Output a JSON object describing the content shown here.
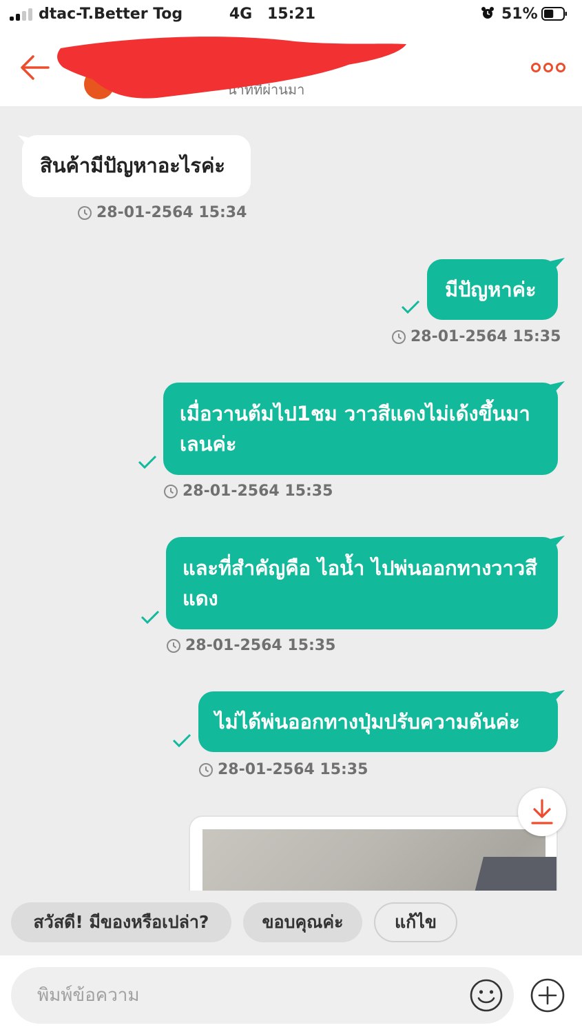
{
  "status_bar": {
    "carrier": "dtac-T.Better Tog",
    "network": "4G",
    "time": "15:21",
    "battery_percent": "51%",
    "battery_level": 0.51,
    "signal_bars": 2
  },
  "header": {
    "contact_name": "",
    "subtitle": "นาทีที่ผ่านมา",
    "accent_color": "#ee4d2d"
  },
  "messages": [
    {
      "direction": "in",
      "text": "สินค้ามีปัญหาอะไรค่ะ",
      "timestamp": "28-01-2564 15:34"
    },
    {
      "direction": "out",
      "text": "มีปัญหาค่ะ",
      "timestamp": "28-01-2564 15:35",
      "read": true
    },
    {
      "direction": "out",
      "text": "เมื่อวานต้มไป1ชม วาวสีแดงไม่เด้งขึ้นมาเลนค่ะ",
      "timestamp": "28-01-2564 15:35",
      "read": true
    },
    {
      "direction": "out",
      "text": "และที่สำคัญคือ ไอน้ำ ไปพ่นออกทางวาวสีแดง",
      "timestamp": "28-01-2564 15:35",
      "read": true
    },
    {
      "direction": "out",
      "text": "ไม่ได้พ่นออกทางปุ่มปรับความดันค่ะ",
      "timestamp": "28-01-2564 15:35",
      "read": true
    }
  ],
  "image_message": {
    "type": "photo"
  },
  "quick_replies": [
    "สวัสดี! มีของหรือเปล่า?",
    "ขอบคุณค่ะ",
    "แก้ไข"
  ],
  "input": {
    "placeholder": "พิมพ์ข้อความ",
    "value": ""
  },
  "colors": {
    "outgoing_bubble": "#12b99a",
    "incoming_bubble": "#ffffff",
    "chat_background": "#ededed",
    "check_mark": "#12b99a"
  }
}
